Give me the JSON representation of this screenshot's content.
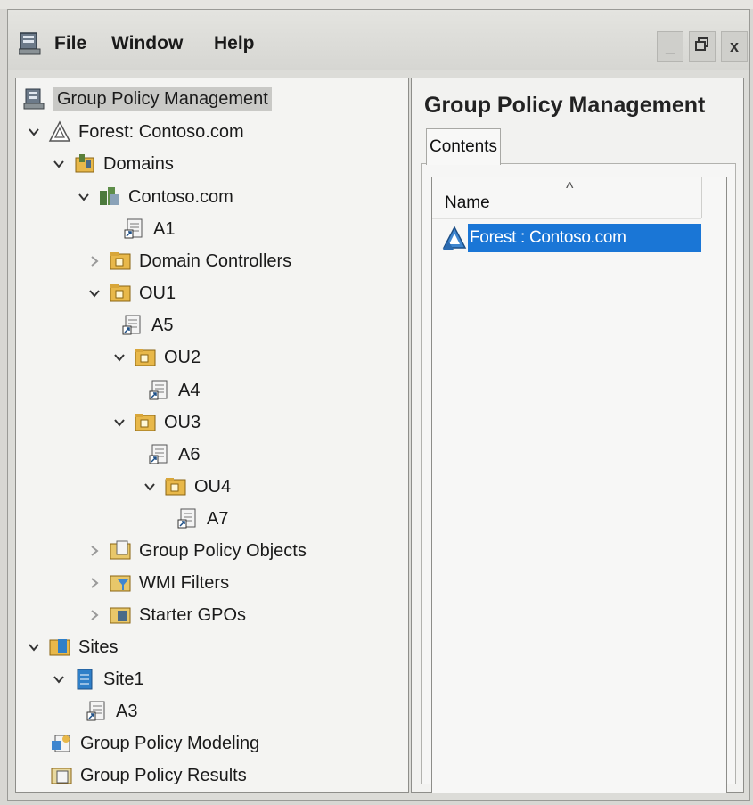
{
  "menu": {
    "file": "File",
    "window": "Window",
    "help": "Help"
  },
  "window_controls": {
    "minimize": "_",
    "restore": "🗗",
    "close": "x"
  },
  "tree": [
    {
      "label": "Group Policy Management",
      "icon": "gpm-console-icon",
      "chevron": ""
    },
    {
      "label": "Forest: Contoso.com",
      "icon": "forest-icon",
      "chevron": "down"
    },
    {
      "label": "Domains",
      "icon": "domains-icon",
      "chevron": "down"
    },
    {
      "label": "Contoso.com",
      "icon": "domain-icon",
      "chevron": "down"
    },
    {
      "label": "A1",
      "icon": "gpo-link-icon",
      "chevron": ""
    },
    {
      "label": "Domain Controllers",
      "icon": "ou-folder-icon",
      "chevron": "right"
    },
    {
      "label": "OU1",
      "icon": "ou-folder-icon",
      "chevron": "down"
    },
    {
      "label": "A5",
      "icon": "gpo-link-icon",
      "chevron": ""
    },
    {
      "label": "OU2",
      "icon": "ou-folder-icon",
      "chevron": "down"
    },
    {
      "label": "A4",
      "icon": "gpo-link-icon",
      "chevron": ""
    },
    {
      "label": "OU3",
      "icon": "ou-folder-icon",
      "chevron": "down"
    },
    {
      "label": "A6",
      "icon": "gpo-link-icon",
      "chevron": ""
    },
    {
      "label": "OU4",
      "icon": "ou-folder-icon",
      "chevron": "down"
    },
    {
      "label": "A7",
      "icon": "gpo-link-icon",
      "chevron": ""
    },
    {
      "label": "Group Policy Objects",
      "icon": "gpo-container-icon",
      "chevron": "right"
    },
    {
      "label": "WMI Filters",
      "icon": "wmi-filters-icon",
      "chevron": "right"
    },
    {
      "label": "Starter GPOs",
      "icon": "starter-gpos-icon",
      "chevron": "right"
    },
    {
      "label": "Sites",
      "icon": "sites-icon",
      "chevron": "down"
    },
    {
      "label": "Site1",
      "icon": "site-icon",
      "chevron": "down"
    },
    {
      "label": "A3",
      "icon": "gpo-link-icon",
      "chevron": ""
    },
    {
      "label": "Group Policy Modeling",
      "icon": "gp-modeling-icon",
      "chevron": ""
    },
    {
      "label": "Group Policy Results",
      "icon": "gp-results-icon",
      "chevron": ""
    }
  ],
  "right_pane": {
    "title": "Group Policy Management",
    "tab": "Contents",
    "column_header": "Name",
    "items": [
      {
        "label": "Forest : Contoso.com",
        "selected": true
      }
    ]
  },
  "colors": {
    "selection": "#1a76d6",
    "folder": "#e8b84a"
  }
}
